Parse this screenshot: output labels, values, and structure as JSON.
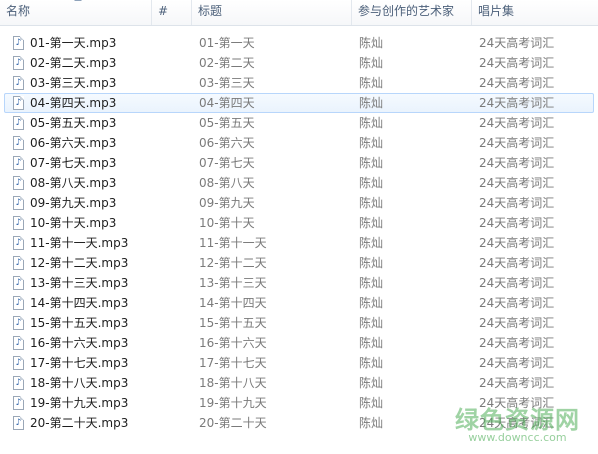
{
  "columns": {
    "name": "名称",
    "number": "#",
    "title": "标题",
    "artist": "参与创作的艺术家",
    "album": "唱片集"
  },
  "files": [
    {
      "name": "01-第一天.mp3",
      "title": "01-第一天",
      "artist": "陈灿",
      "album": "24天高考词汇"
    },
    {
      "name": "02-第二天.mp3",
      "title": "02-第二天",
      "artist": "陈灿",
      "album": "24天高考词汇"
    },
    {
      "name": "03-第三天.mp3",
      "title": "03-第三天",
      "artist": "陈灿",
      "album": "24天高考词汇"
    },
    {
      "name": "04-第四天.mp3",
      "title": "04-第四天",
      "artist": "陈灿",
      "album": "24天高考词汇"
    },
    {
      "name": "05-第五天.mp3",
      "title": "05-第五天",
      "artist": "陈灿",
      "album": "24天高考词汇"
    },
    {
      "name": "06-第六天.mp3",
      "title": "06-第六天",
      "artist": "陈灿",
      "album": "24天高考词汇"
    },
    {
      "name": "07-第七天.mp3",
      "title": "07-第七天",
      "artist": "陈灿",
      "album": "24天高考词汇"
    },
    {
      "name": "08-第八天.mp3",
      "title": "08-第八天",
      "artist": "陈灿",
      "album": "24天高考词汇"
    },
    {
      "name": "09-第九天.mp3",
      "title": "09-第九天",
      "artist": "陈灿",
      "album": "24天高考词汇"
    },
    {
      "name": "10-第十天.mp3",
      "title": "10-第十天",
      "artist": "陈灿",
      "album": "24天高考词汇"
    },
    {
      "name": "11-第十一天.mp3",
      "title": "11-第十一天",
      "artist": "陈灿",
      "album": "24天高考词汇"
    },
    {
      "name": "12-第十二天.mp3",
      "title": "12-第十二天",
      "artist": "陈灿",
      "album": "24天高考词汇"
    },
    {
      "name": "13-第十三天.mp3",
      "title": "13-第十三天",
      "artist": "陈灿",
      "album": "24天高考词汇"
    },
    {
      "name": "14-第十四天.mp3",
      "title": "14-第十四天",
      "artist": "陈灿",
      "album": "24天高考词汇"
    },
    {
      "name": "15-第十五天.mp3",
      "title": "15-第十五天",
      "artist": "陈灿",
      "album": "24天高考词汇"
    },
    {
      "name": "16-第十六天.mp3",
      "title": "16-第十六天",
      "artist": "陈灿",
      "album": "24天高考词汇"
    },
    {
      "name": "17-第十七天.mp3",
      "title": "17-第十七天",
      "artist": "陈灿",
      "album": "24天高考词汇"
    },
    {
      "name": "18-第十八天.mp3",
      "title": "18-第十八天",
      "artist": "陈灿",
      "album": "24天高考词汇"
    },
    {
      "name": "19-第十九天.mp3",
      "title": "19-第十九天",
      "artist": "陈灿",
      "album": "24天高考词汇"
    },
    {
      "name": "20-第二十天.mp3",
      "title": "20-第二十天",
      "artist": "陈灿",
      "album": "24天高考词汇"
    }
  ],
  "hovered_row_index": 3,
  "file_icon": "music-file-icon",
  "watermark": {
    "text": "绿色资源网",
    "url": "www.downcc.com"
  },
  "colors": {
    "header_text": "#4c607a",
    "hover_border": "#b8d6fb",
    "muted_text": "#7a7a7a",
    "watermark": "#50af5a"
  }
}
